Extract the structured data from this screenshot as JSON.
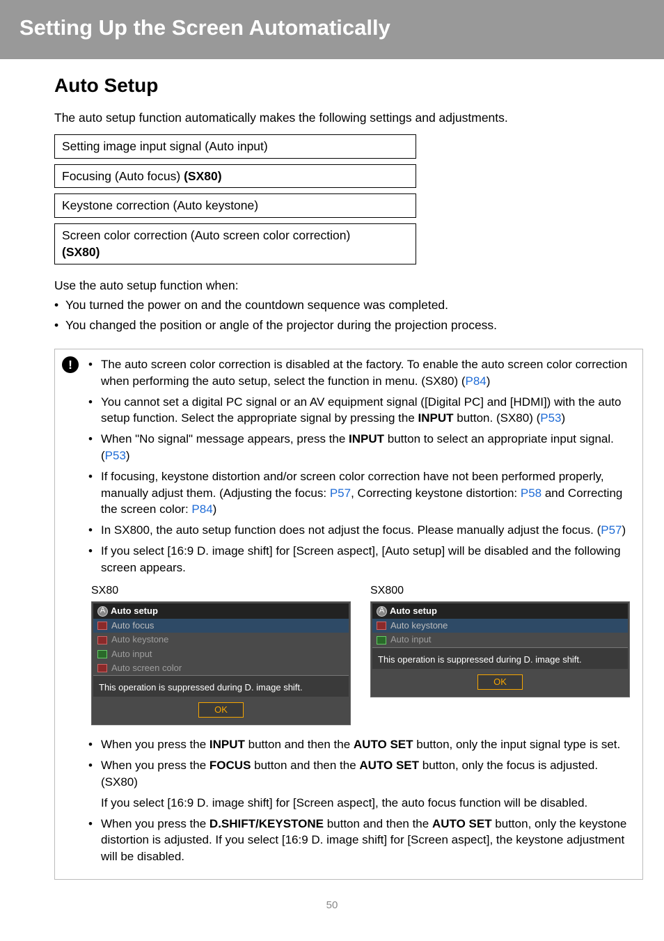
{
  "header": "Setting Up the Screen Automatically",
  "section_title": "Auto Setup",
  "intro": "The auto setup function automatically makes the following settings and adjustments.",
  "boxes": {
    "b1": "Setting image input signal (Auto input)",
    "b2_pre": "Focusing (Auto focus) ",
    "b2_bold": "(SX80)",
    "b3": "Keystone correction (Auto keystone)",
    "b4_l1": "Screen color correction (Auto screen color correction)",
    "b4_l2": "(SX80)"
  },
  "lead": "Use the auto setup function when:",
  "bullets": {
    "a": "You turned the power on and the countdown sequence was completed.",
    "b": "You changed the position or angle of the projector during the projection process."
  },
  "note_icon": "!",
  "notes": {
    "n1_a": "The auto screen color correction is disabled at the factory. To enable the auto screen color correction when performing the auto setup, select the function in menu. (SX80) (",
    "n1_link": "P84",
    "n1_b": ")",
    "n2_a": "You cannot set a digital PC signal or an AV equipment signal ([Digital PC] and [HDMI]) with the auto setup function. Select the appropriate signal by pressing the ",
    "n2_bold": "INPUT",
    "n2_b": " button. (SX80) (",
    "n2_link": "P53",
    "n2_c": ")",
    "n3_a": "When \"No signal\" message appears, press the ",
    "n3_bold": "INPUT",
    "n3_b": " button to select an appropriate input signal. (",
    "n3_link": "P53",
    "n3_c": ")",
    "n4_a": "If focusing, keystone distortion and/or screen color correction have not been performed properly, manually adjust them. (Adjusting the focus: ",
    "n4_link1": "P57",
    "n4_b": ", Correcting keystone distortion: ",
    "n4_link2": "P58",
    "n4_c": " and Correcting the screen color: ",
    "n4_link3": "P84",
    "n4_d": ")",
    "n5_a": "In SX800, the auto setup function does not adjust the focus. Please manually adjust the focus. (",
    "n5_link": "P57",
    "n5_b": ")",
    "n6": "If you select [16:9 D. image shift] for [Screen aspect], [Auto setup] will be disabled and the following screen appears.",
    "n7_a": "When you press the ",
    "n7_b1": "INPUT",
    "n7_b": " button and then the ",
    "n7_b2": "AUTO SET",
    "n7_c": " button, only the input signal type is set.",
    "n8_a": "When you press the ",
    "n8_b1": "FOCUS",
    "n8_b": " button and then the ",
    "n8_b2": "AUTO SET",
    "n8_c": " button, only the focus is adjusted. (SX80)",
    "n8_cont": "If you select [16:9 D. image shift] for [Screen aspect], the auto focus function will be disabled.",
    "n9_a": "When you press the ",
    "n9_b1": "D.SHIFT/KEYSTONE",
    "n9_b": " button and then the ",
    "n9_b2": "AUTO SET",
    "n9_c": " button, only the keystone distortion is adjusted. If you select [16:9 D. image shift] for [Screen aspect], the keystone adjustment will be disabled."
  },
  "screens": {
    "left_label": "SX80",
    "right_label": "SX800",
    "title_badge": "A",
    "title_text": "Auto setup",
    "left_items": {
      "i1": "Auto focus",
      "i2": "Auto keystone",
      "i3": "Auto input",
      "i4": "Auto screen color"
    },
    "right_items": {
      "i1": "Auto keystone",
      "i2": "Auto input"
    },
    "msg": "This operation is suppressed during D. image shift.",
    "ok": "OK"
  },
  "page_number": "50"
}
